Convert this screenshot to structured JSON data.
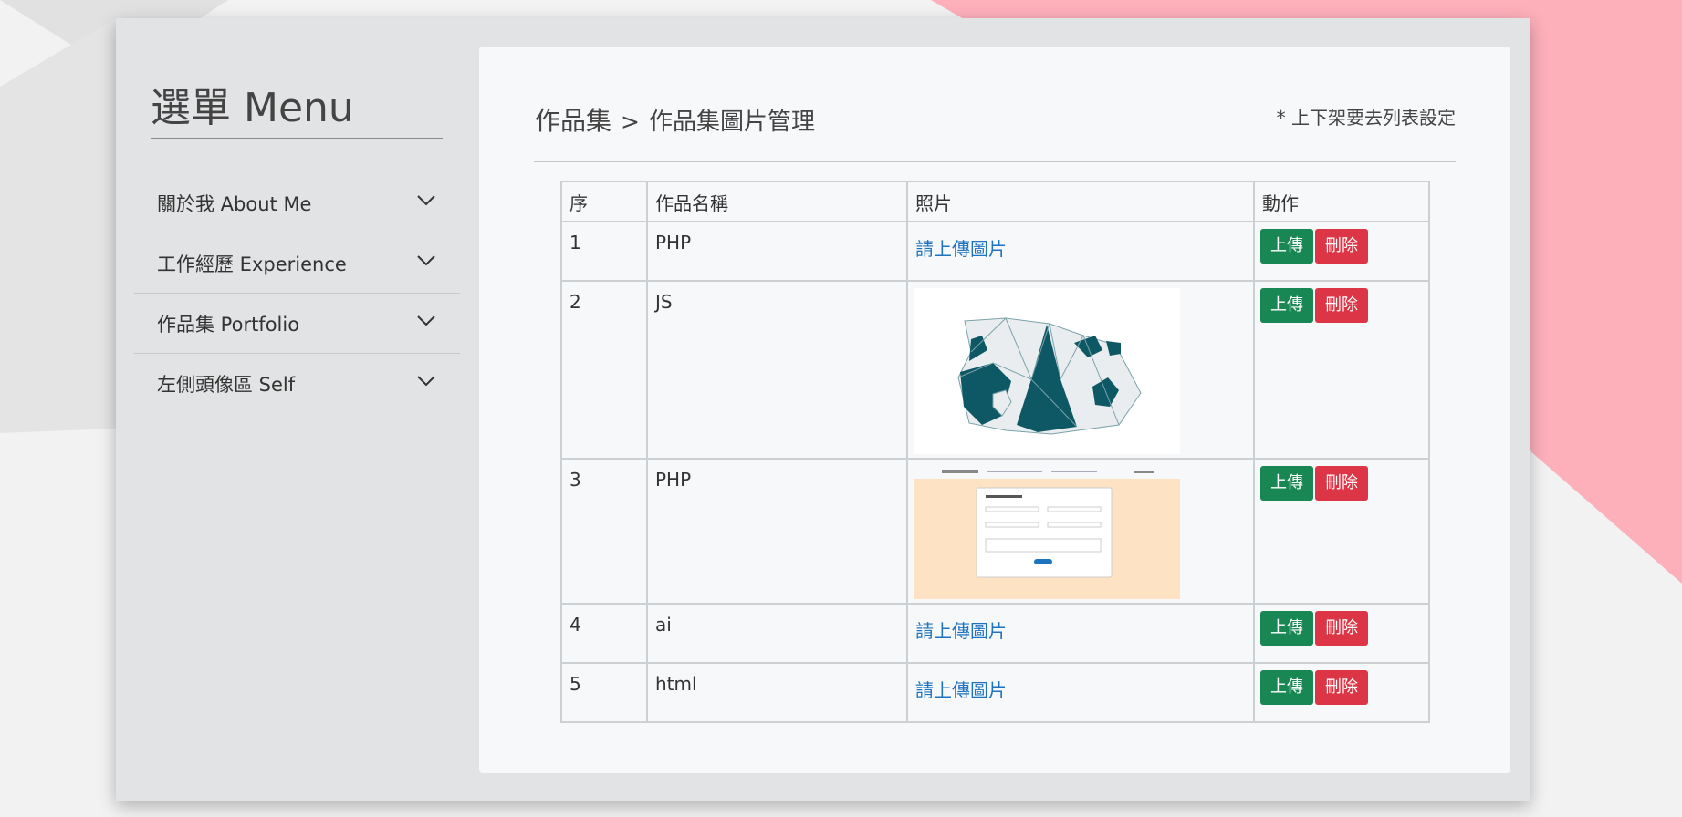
{
  "sidebar": {
    "title": "選單 Menu",
    "items": [
      {
        "label": "關於我 About Me",
        "icon": "chevron-down-icon"
      },
      {
        "label": "工作經歷 Experience",
        "icon": "chevron-down-icon"
      },
      {
        "label": "作品集 Portfolio",
        "icon": "chevron-down-icon"
      },
      {
        "label": "左側頭像區 Self",
        "icon": "chevron-down-icon"
      }
    ]
  },
  "header": {
    "section": "作品集",
    "separator": ">",
    "current": "作品集圖片管理",
    "note": "* 上下架要去列表設定"
  },
  "table": {
    "columns": [
      "序",
      "作品名稱",
      "照片",
      "動作"
    ],
    "rows": [
      {
        "index": "1",
        "name": "PHP",
        "photo": "請上傳圖片"
      },
      {
        "index": "2",
        "name": "JS",
        "photo": "panda-image"
      },
      {
        "index": "3",
        "name": "PHP",
        "photo": "form-screenshot-image"
      },
      {
        "index": "4",
        "name": "ai",
        "photo": "請上傳圖片"
      },
      {
        "index": "5",
        "name": "html",
        "photo": "請上傳圖片"
      }
    ],
    "upload_label": "上傳",
    "delete_label": "刪除"
  },
  "colors": {
    "upload_button": "#198754",
    "delete_button": "#dc3545",
    "link": "#1d73bf",
    "accent_pink": "#fdafba",
    "panda_teal": "#0e5866"
  }
}
